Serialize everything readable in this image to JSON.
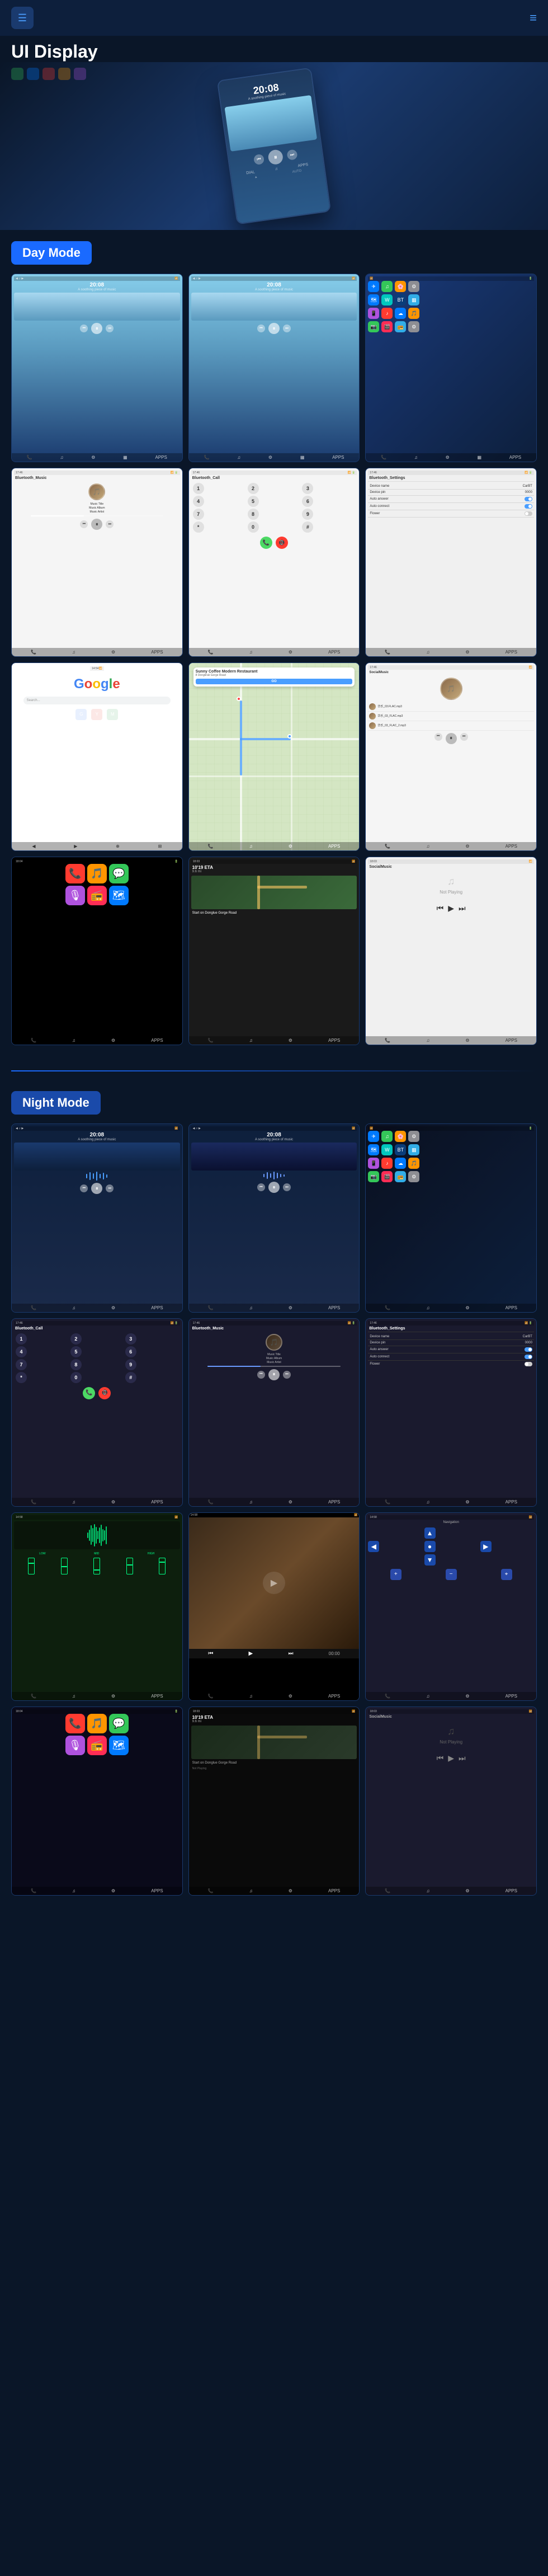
{
  "header": {
    "title": "UI Display",
    "menu_icon": "☰",
    "nav_icon": "≡"
  },
  "hero": {
    "device_time": "20:08",
    "device_subtitle": "A soothing piece of music"
  },
  "day_mode": {
    "label": "Day Mode"
  },
  "night_mode": {
    "label": "Night Mode"
  },
  "screens": {
    "time": "20:08",
    "subtitle": "A soothing piece of music",
    "music_title": "Music Title",
    "music_album": "Music Album",
    "music_artist": "Music Artist",
    "bluetooth_music": "Bluetooth_Music",
    "bluetooth_call": "Bluetooth_Call",
    "bluetooth_settings": "Bluetooth_Settings",
    "device_name_label": "Device name",
    "device_name_value": "CarBT",
    "device_pin_label": "Device pin",
    "device_pin_value": "0000",
    "auto_answer_label": "Auto answer",
    "auto_connect_label": "Auto connect",
    "flower_label": "Flower",
    "google_text": "Google",
    "sunny_coffee": "Sunny Coffee Modern Restaurant",
    "sunny_address": "8 Dongkrak Gorge Road",
    "eta_label": "10'19 ETA",
    "distance": "9.6 mi",
    "go_label": "GO",
    "not_playing": "Not Playing",
    "start_on": "Start on Donglue Gorge Road",
    "local_music_files": [
      "华乐_03.FLAC.mp3",
      "华乐_03_FLAC.mp3",
      "华乐_03_FLAC_2.mp3"
    ]
  },
  "colors": {
    "day_mode_bg": "#4a9eff",
    "night_mode_bg": "#1a4aaa",
    "accent": "#4a9eff",
    "brand": "#0a1628"
  }
}
